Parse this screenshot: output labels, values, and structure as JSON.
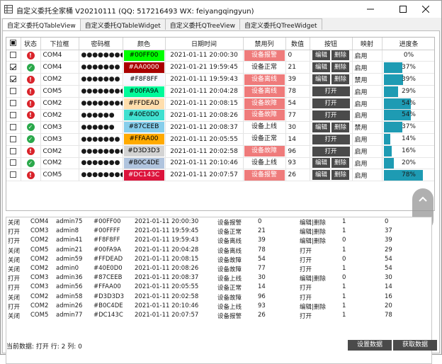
{
  "window": {
    "title": "自定义委托全家桶 V20210111 (QQ: 517216493 WX: feiyangqingyun)",
    "controls": [
      "minimize",
      "maximize",
      "close"
    ]
  },
  "tabs": [
    {
      "label": "自定义委托QTableView",
      "active": true
    },
    {
      "label": "自定义委托QTableWidget",
      "active": false
    },
    {
      "label": "自定义委托QTreeView",
      "active": false
    },
    {
      "label": "自定义委托QTreeWidget",
      "active": false
    }
  ],
  "table": {
    "headers": [
      "",
      "状态",
      "下拉框",
      "密码框",
      "颜色",
      "日期时间",
      "禁用列",
      "数值",
      "按钮",
      "映射",
      "进度条"
    ],
    "rows": [
      {
        "checked": false,
        "status": "error",
        "port": "COM4",
        "password": "●●●●●●●●",
        "color": "#00FF00",
        "text_color": "#000000",
        "datetime": "2021-01-11 20:00:30",
        "disabled_text": "设备报警",
        "alert": true,
        "value": "0",
        "button": "double",
        "mapping": "启用",
        "progress": 0
      },
      {
        "checked": true,
        "status": "ok",
        "port": "COM4",
        "password": "●●●●●●●",
        "color": "#AA0000",
        "text_color": "#ffffff",
        "datetime": "2021-01-21 19:59:45",
        "disabled_text": "设备正常",
        "alert": false,
        "value": "21",
        "button": "double",
        "mapping": "启用",
        "progress": 37
      },
      {
        "checked": true,
        "status": "error",
        "port": "COM2",
        "password": "●●●●●●●",
        "color": "#F8F8FF",
        "text_color": "#000000",
        "datetime": "2021-01-11 19:59:43",
        "disabled_text": "设备离线",
        "alert": true,
        "value": "39",
        "button": "double",
        "mapping": "禁用",
        "progress": 39
      },
      {
        "checked": false,
        "status": "error",
        "port": "COM5",
        "password": "●●●●●●●●",
        "color": "#00FA9A",
        "text_color": "#000000",
        "datetime": "2021-01-11 20:04:28",
        "disabled_text": "设备离线",
        "alert": true,
        "value": "78",
        "button": "open",
        "mapping": "启用",
        "progress": 29
      },
      {
        "checked": false,
        "status": "error",
        "port": "COM2",
        "password": "●●●●●●●●",
        "color": "#FFDEAD",
        "text_color": "#000000",
        "datetime": "2021-01-11 20:08:15",
        "disabled_text": "设备故障",
        "alert": true,
        "value": "54",
        "button": "open",
        "mapping": "启用",
        "progress": 54
      },
      {
        "checked": false,
        "status": "error",
        "port": "COM2",
        "password": "●●●●●●",
        "color": "#40E0D0",
        "text_color": "#000000",
        "datetime": "2021-01-11 20:08:26",
        "disabled_text": "设备故障",
        "alert": true,
        "value": "77",
        "button": "open",
        "mapping": "启用",
        "progress": 54
      },
      {
        "checked": false,
        "status": "ok",
        "port": "COM3",
        "password": "●●●●●●",
        "color": "#87CEEB",
        "text_color": "#000000",
        "datetime": "2021-01-11 20:08:37",
        "disabled_text": "设备上线",
        "alert": false,
        "value": "30",
        "button": "double",
        "mapping": "禁用",
        "progress": 37
      },
      {
        "checked": false,
        "status": "ok",
        "port": "COM3",
        "password": "●●●●●●●",
        "color": "#FFAA00",
        "text_color": "#000000",
        "datetime": "2021-01-11 20:05:55",
        "disabled_text": "设备正常",
        "alert": false,
        "value": "14",
        "button": "open",
        "mapping": "启用",
        "progress": 14
      },
      {
        "checked": false,
        "status": "error",
        "port": "COM2",
        "password": "●●●●●●●●",
        "color": "#D3D3D3",
        "text_color": "#000000",
        "datetime": "2021-01-11 20:02:58",
        "disabled_text": "设备故障",
        "alert": true,
        "value": "96",
        "button": "open",
        "mapping": "启用",
        "progress": 16
      },
      {
        "checked": false,
        "status": "ok",
        "port": "COM2",
        "password": "●●●●●●●",
        "color": "#B0C4DE",
        "text_color": "#000000",
        "datetime": "2021-01-11 20:10:46",
        "disabled_text": "设备上线",
        "alert": false,
        "value": "93",
        "button": "double",
        "mapping": "启用",
        "progress": 20
      },
      {
        "checked": false,
        "status": "error",
        "port": "COM5",
        "password": "●●●●●●●●",
        "color": "#DC143C",
        "text_color": "#ffffff",
        "datetime": "2021-01-11 20:07:57",
        "disabled_text": "设备报警",
        "alert": true,
        "value": "26",
        "button": "double",
        "mapping": "启用",
        "progress": 78
      }
    ],
    "button_labels": {
      "edit": "编辑",
      "delete": "删除",
      "open": "打开"
    }
  },
  "list_rows": [
    [
      "关闭",
      "COM4",
      "admin75",
      "#00FF00",
      "2021-01-11 20:00:30",
      "设备报警",
      "0",
      "编辑|删除",
      "1",
      "0"
    ],
    [
      "打开",
      "COM3",
      "admin8",
      "#00FFFF",
      "2021-01-11 19:59:45",
      "设备正常",
      "21",
      "编辑|删除",
      "1",
      "37"
    ],
    [
      "打开",
      "COM2",
      "admin41",
      "#F8F8FF",
      "2021-01-11 19:59:43",
      "设备离线",
      "39",
      "编辑|删除",
      "0",
      "39"
    ],
    [
      "关闭",
      "COM5",
      "admin21",
      "#00FA9A",
      "2021-01-11 20:04:28",
      "设备离线",
      "78",
      "打开",
      "1",
      "29"
    ],
    [
      "关闭",
      "COM2",
      "admin59",
      "#FFDEAD",
      "2021-01-11 20:08:15",
      "设备故障",
      "54",
      "打开",
      "0",
      "54"
    ],
    [
      "关闭",
      "COM2",
      "admin0",
      "#40E0D0",
      "2021-01-11 20:08:26",
      "设备故障",
      "77",
      "打开",
      "1",
      "54"
    ],
    [
      "打开",
      "COM3",
      "admin36",
      "#87CEEB",
      "2021-01-11 20:08:37",
      "设备上线",
      "30",
      "编辑|删除",
      "0",
      "30"
    ],
    [
      "打开",
      "COM3",
      "admin56",
      "#FFAA00",
      "2021-01-11 20:05:55",
      "设备正常",
      "14",
      "打开",
      "1",
      "14"
    ],
    [
      "关闭",
      "COM2",
      "admin58",
      "#D3D3D3",
      "2021-01-11 20:02:58",
      "设备故障",
      "96",
      "打开",
      "1",
      "16"
    ],
    [
      "打开",
      "COM2",
      "admin26",
      "#B0C4DE",
      "2021-01-11 20:10:46",
      "设备上线",
      "93",
      "编辑|删除",
      "1",
      "20"
    ],
    [
      "关闭",
      "COM5",
      "admin77",
      "#DC143C",
      "2021-01-11 20:07:57",
      "设备报警",
      "26",
      "打开",
      "1",
      "78"
    ]
  ],
  "status_bar": {
    "text": "当前数据: 打开 行: 2 列: 0",
    "set_button": "设置数据",
    "get_button": "获取数据"
  },
  "colors": {
    "accent": "#1e9bb3",
    "alert": "#ef7b7b",
    "button": "#4a4a4a",
    "ok": "#2aa84a",
    "error": "#d9232a"
  }
}
